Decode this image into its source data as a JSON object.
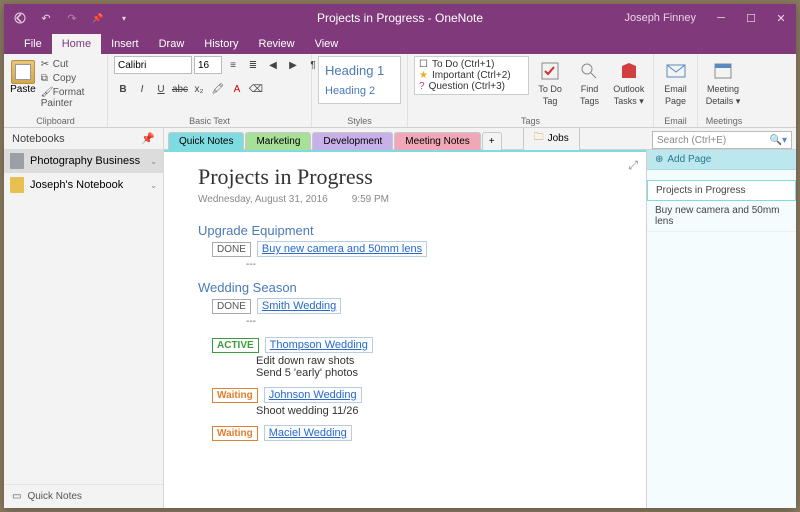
{
  "title": "Projects in Progress  -  OneNote",
  "user": "Joseph Finney",
  "menu": {
    "file": "File",
    "home": "Home",
    "insert": "Insert",
    "draw": "Draw",
    "history": "History",
    "review": "Review",
    "view": "View"
  },
  "ribbon": {
    "paste": "Paste",
    "cut": "Cut",
    "copy": "Copy",
    "fp": "Format Painter",
    "clipboard": "Clipboard",
    "font": "Calibri",
    "size": "16",
    "basic": "Basic Text",
    "h1": "Heading 1",
    "h2": "Heading 2",
    "styles": "Styles",
    "tag_todo": "To Do (Ctrl+1)",
    "tag_imp": "Important (Ctrl+2)",
    "tag_q": "Question (Ctrl+3)",
    "tags": "Tags",
    "todo": "To Do",
    "find": "Find",
    "outlook": "Outlook",
    "tag_btn": "Tag",
    "tags_btn": "Tags",
    "tasks": "Tasks ▾",
    "email": "Email",
    "page": "Page",
    "email_lbl": "Email",
    "meeting": "Meeting",
    "details": "Details ▾",
    "meetings": "Meetings"
  },
  "nb": {
    "hdr": "Notebooks",
    "items": [
      {
        "label": "Photography Business",
        "color": "#9aa0a6"
      },
      {
        "label": "Joseph's Notebook",
        "color": "#e8c050"
      }
    ],
    "qn": "Quick Notes"
  },
  "sections": {
    "qn": "Quick Notes",
    "mk": "Marketing",
    "dv": "Development",
    "mn": "Meeting Notes",
    "jobs": "Jobs"
  },
  "search_ph": "Search (Ctrl+E)",
  "pages": {
    "add": "Add Page",
    "items": [
      "Projects in Progress",
      "Buy new camera and 50mm lens"
    ]
  },
  "page": {
    "title": "Projects in Progress",
    "date": "Wednesday, August 31, 2016",
    "time": "9:59 PM",
    "s1": "Upgrade Equipment",
    "s1_status": "DONE",
    "s1_link": "Buy new camera and 50mm lens",
    "s2": "Wedding Season",
    "r1_status": "DONE",
    "r1_link": "Smith Wedding",
    "r2_status": "ACTIVE",
    "r2_link": "Thompson Wedding",
    "r2_a": "Edit down raw shots",
    "r2_b": "Send 5 'early' photos",
    "r3_status": "Waiting",
    "r3_link": "Johnson Wedding",
    "r3_a": "Shoot wedding 11/26",
    "r4_status": "Waiting",
    "r4_link": "Maciel  Wedding",
    "sep": "---"
  }
}
